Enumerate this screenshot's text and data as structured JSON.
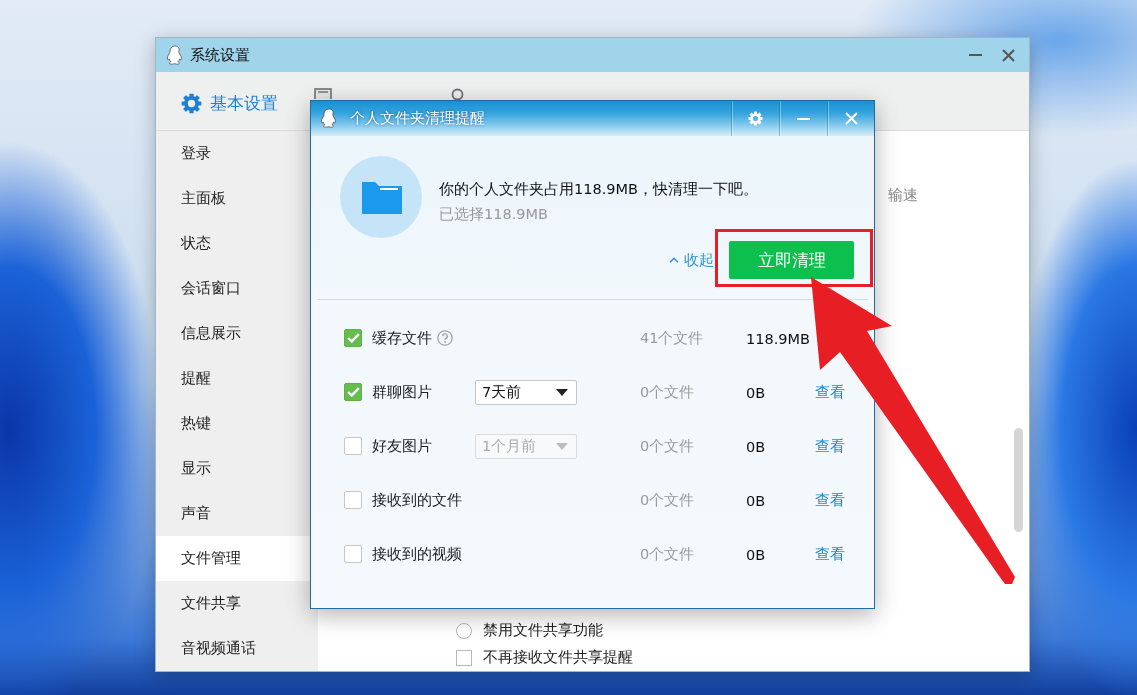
{
  "settings_window": {
    "title": "系统设置",
    "tabs": [
      {
        "label": "基本设置",
        "selected": true
      },
      {
        "selected": false
      },
      {
        "selected": false
      }
    ],
    "sidebar": {
      "items": [
        {
          "label": "登录",
          "selected": false
        },
        {
          "label": "主面板",
          "selected": false
        },
        {
          "label": "状态",
          "selected": false
        },
        {
          "label": "会话窗口",
          "selected": false
        },
        {
          "label": "信息展示",
          "selected": false
        },
        {
          "label": "提醒",
          "selected": false
        },
        {
          "label": "热键",
          "selected": false
        },
        {
          "label": "显示",
          "selected": false
        },
        {
          "label": "声音",
          "selected": false
        },
        {
          "label": "文件管理",
          "selected": true
        },
        {
          "label": "文件共享",
          "selected": false
        },
        {
          "label": "音视频通话",
          "selected": false
        }
      ]
    },
    "content": {
      "text_fragment": "输速",
      "options": [
        {
          "kind": "radio",
          "label": "禁用文件共享功能",
          "checked": false
        },
        {
          "kind": "checkbox",
          "label": "不再接收文件共享提醒",
          "checked": false
        }
      ]
    }
  },
  "dialog": {
    "title": "个人文件夹清理提醒",
    "message": "你的个人文件夹占用118.9MB，快清理一下吧。",
    "selection": "已选择118.9MB",
    "collapse_link": "收起",
    "clean_button": "立即清理",
    "items": [
      {
        "label": "缓存文件",
        "checked": true,
        "help": true,
        "count": "41个文件",
        "size": "118.9MB"
      },
      {
        "label": "群聊图片",
        "checked": true,
        "help": false,
        "dropdown": {
          "value": "7天前",
          "disabled": false
        },
        "count": "0个文件",
        "size": "0B",
        "link": "查看"
      },
      {
        "label": "好友图片",
        "checked": false,
        "help": false,
        "dropdown": {
          "value": "1个月前",
          "disabled": true
        },
        "count": "0个文件",
        "size": "0B",
        "link": "查看"
      },
      {
        "label": "接收到的文件",
        "checked": false,
        "help": false,
        "count": "0个文件",
        "size": "0B",
        "link": "查看"
      },
      {
        "label": "接收到的视频",
        "checked": false,
        "help": false,
        "count": "0个文件",
        "size": "0B",
        "link": "查看"
      }
    ]
  }
}
